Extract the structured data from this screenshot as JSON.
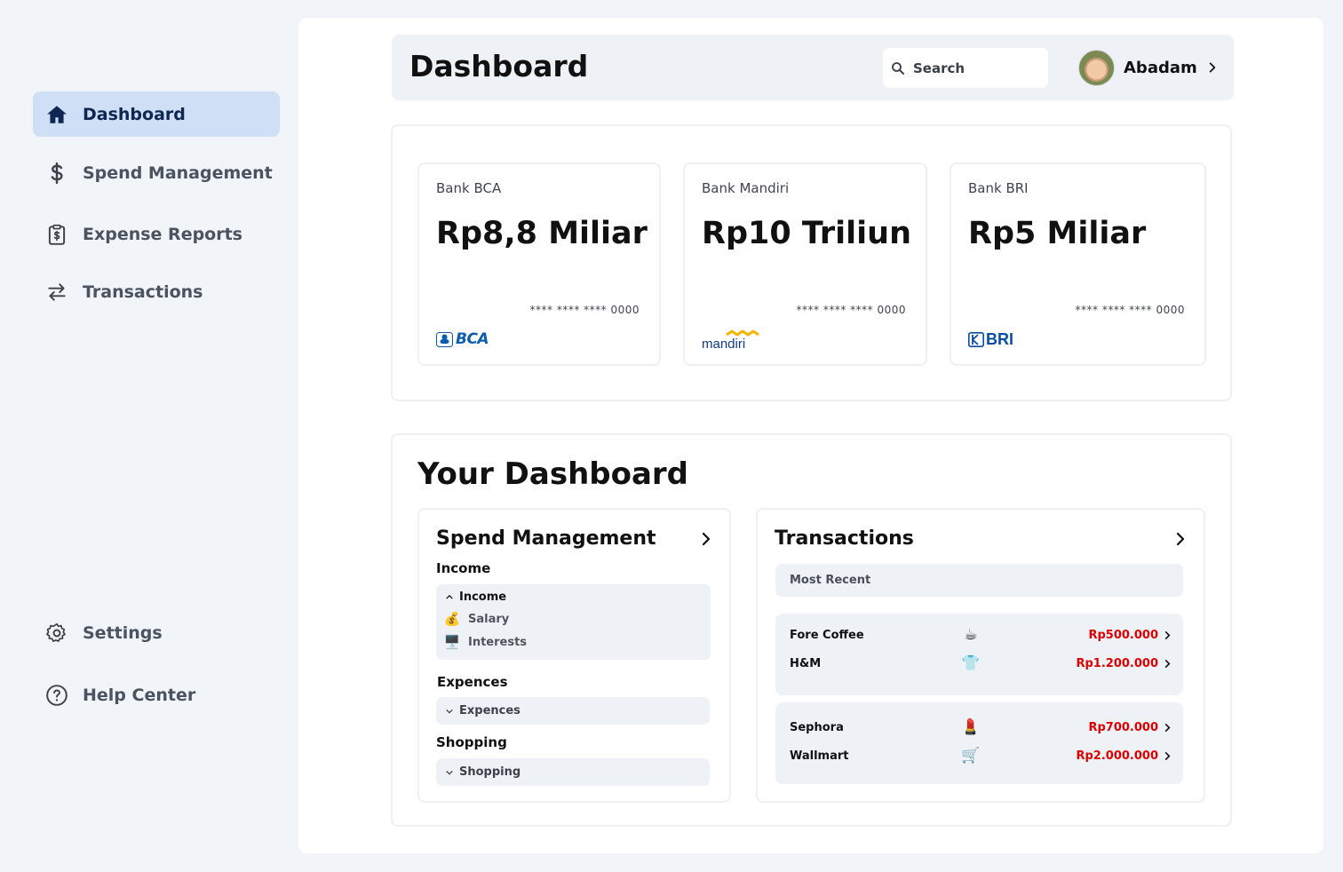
{
  "sidebar": {
    "items": [
      {
        "label": "Dashboard",
        "icon": "home-icon",
        "active": true
      },
      {
        "label": "Spend Management",
        "icon": "dollar-icon",
        "active": false
      },
      {
        "label": "Expense Reports",
        "icon": "clipboard-dollar-icon",
        "active": false
      },
      {
        "label": "Transactions",
        "icon": "arrows-exchange-icon",
        "active": false
      }
    ],
    "bottom_items": [
      {
        "label": "Settings",
        "icon": "gear-icon"
      },
      {
        "label": "Help Center",
        "icon": "help-circle-icon"
      }
    ]
  },
  "header": {
    "title": "Dashboard",
    "search_placeholder": "Search",
    "user_name": "Abadam"
  },
  "banks": [
    {
      "name": "Bank BCA",
      "balance": "Rp8,8 Miliar",
      "card_number": "**** **** **** 0000",
      "logo_text": "BCA",
      "logo_color": "#0a5cad"
    },
    {
      "name": "Bank Mandiri",
      "balance": "Rp10 Triliun",
      "card_number": "**** **** **** 0000",
      "logo_text": "mandiri",
      "logo_color": "#0d3c84"
    },
    {
      "name": "Bank BRI",
      "balance": "Rp5 Miliar",
      "card_number": "**** **** **** 0000",
      "logo_text": "BRI",
      "logo_color": "#0a4da2"
    }
  ],
  "your_dashboard": {
    "title": "Your Dashboard",
    "spend": {
      "title": "Spend Management",
      "income_label": "Income",
      "income_accordion": {
        "title": "Income",
        "rows": [
          {
            "icon": "💰",
            "label": "Salary"
          },
          {
            "icon": "🖥️",
            "label": "Interests"
          }
        ]
      },
      "expences_label": "Expences",
      "expences_accordion": {
        "title": "Expences"
      },
      "shopping_label": "Shopping",
      "shopping_accordion": {
        "title": "Shopping"
      }
    },
    "transactions": {
      "title": "Transactions",
      "filter": "Most Recent",
      "groups": [
        [
          {
            "merchant": "Fore Coffee",
            "icon": "☕",
            "amount": "Rp500.000"
          },
          {
            "merchant": "H&M",
            "icon": "👕",
            "amount": "Rp1.200.000"
          }
        ],
        [
          {
            "merchant": "Sephora",
            "icon": "💄",
            "amount": "Rp700.000"
          },
          {
            "merchant": "Wallmart",
            "icon": "🛒",
            "amount": "Rp2.000.000"
          }
        ]
      ]
    }
  },
  "colors": {
    "accent_active_bg": "#cfdff6",
    "accent_active_text": "#0f2752",
    "amount_red": "#e00000"
  }
}
